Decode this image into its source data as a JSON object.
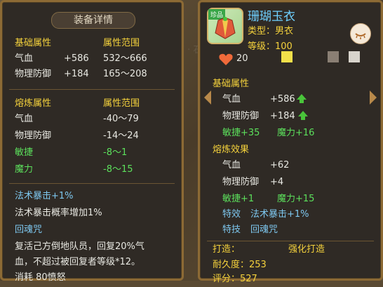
{
  "left": {
    "title": "装备详情",
    "base_header": {
      "left": "基础属性",
      "right": "属性范围"
    },
    "base_rows": [
      {
        "name": "气血",
        "value": "+586",
        "range": "532～666"
      },
      {
        "name": "物理防御",
        "value": "+184",
        "range": "165～208"
      }
    ],
    "refine_header": {
      "left": "熔炼属性",
      "right": "属性范围"
    },
    "refine_rows": [
      {
        "name": "气血",
        "range": "-40～79"
      },
      {
        "name": "物理防御",
        "range": "-14～24"
      },
      {
        "name": "敏捷",
        "range": "-8～1"
      },
      {
        "name": "魔力",
        "range": "-8～15"
      }
    ],
    "skill1": "法术暴击+1%",
    "skill1_desc": "法术暴击概率增加1%",
    "skill2": "回魂咒",
    "skill2_desc1": "复活己方倒地队员，回复20%气",
    "skill2_desc2": "血，不超过被回复者等级*12。",
    "cost": "消耗 80愤怒"
  },
  "right": {
    "badge": "珍品",
    "name": "珊瑚玉衣",
    "type": "类型：男衣",
    "level": "等级：100",
    "heart_count": "20",
    "base_header": "基础属性",
    "base_rows": [
      {
        "name": "气血",
        "value": "+586"
      },
      {
        "name": "物理防御",
        "value": "+184"
      }
    ],
    "base_extra": [
      {
        "name": "敏捷+35"
      },
      {
        "name": "魔力+16"
      }
    ],
    "refine_header": "熔炼效果",
    "refine_rows": [
      {
        "name": "气血",
        "value": "+62"
      },
      {
        "name": "物理防御",
        "value": "+4"
      }
    ],
    "refine_extra": [
      {
        "name": "敏捷+1"
      },
      {
        "name": "魔力+15"
      }
    ],
    "special_label": "特效",
    "special_value": "法术暴击+1%",
    "skill_label": "特技",
    "skill_value": "回魂咒",
    "forge_label": "打造：",
    "forge_value": "强化打造",
    "durability": "耐久度：253",
    "rating": "评分：527"
  },
  "colors": {
    "gold": "#f5d23c",
    "green": "#5ce05c",
    "blue": "#7ec8f0",
    "white": "#e8e8e2"
  }
}
